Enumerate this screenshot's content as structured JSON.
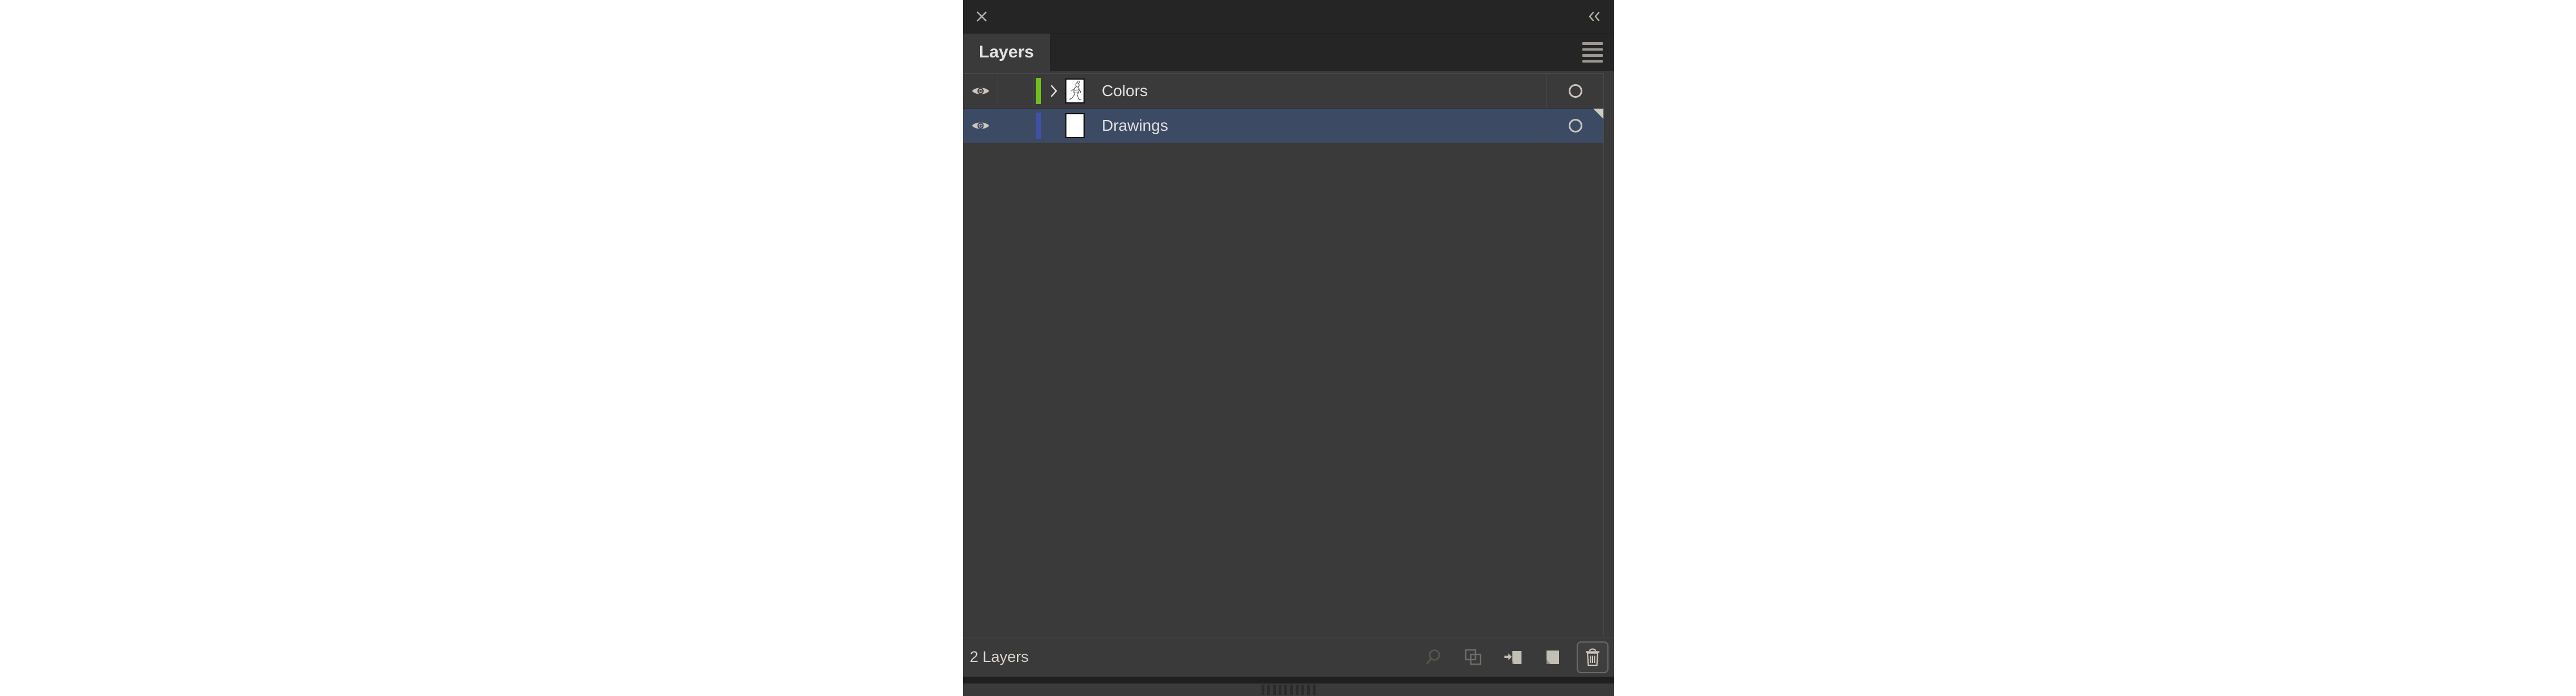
{
  "panel": {
    "title_tab": "Layers",
    "close_icon": "close-icon",
    "collapse_icon": "collapse-to-icons-icon",
    "menu_icon": "panel-menu-icon",
    "colors": {
      "panel_bg": "#3a3a3a",
      "titlebar_bg": "#252525",
      "tab_active_bg": "#3a3a3a",
      "row_selected_bg": "#3d4a63",
      "text": "#e0e0e0",
      "icon": "#c9c7bd",
      "icon_disabled": "#5a5854"
    }
  },
  "layers": [
    {
      "name": "Colors",
      "visible": true,
      "locked": false,
      "selected": false,
      "expandable": true,
      "expanded": false,
      "color": "#6fbf1f",
      "color_name": "green",
      "thumbnail": "artwork-sketch-thumbnail",
      "target_state": "untargeted",
      "visibility_icon": "eye-icon",
      "disclosure_icon": "chevron-right-icon",
      "target_icon": "target-circle-icon"
    },
    {
      "name": "Drawings",
      "visible": true,
      "locked": false,
      "selected": true,
      "expandable": false,
      "expanded": false,
      "color": "#4051a8",
      "color_name": "blue-violet",
      "thumbnail": "blank-white-thumbnail",
      "target_state": "untargeted",
      "visibility_icon": "eye-icon",
      "disclosure_icon": "",
      "target_icon": "target-circle-icon"
    }
  ],
  "footer": {
    "layer_count_label": "2 Layers",
    "tools": [
      {
        "name": "locate-object-button",
        "label": "Locate Object",
        "icon": "magnifier-icon",
        "enabled": false,
        "framed": false
      },
      {
        "name": "make-clipping-mask-button",
        "label": "Make/Release Clipping Mask",
        "icon": "clipping-mask-icon",
        "enabled": true,
        "framed": false
      },
      {
        "name": "create-new-sublayer-button",
        "label": "Create New Sublayer",
        "icon": "new-sublayer-icon",
        "enabled": true,
        "framed": false
      },
      {
        "name": "create-new-layer-button",
        "label": "Create New Layer",
        "icon": "new-layer-icon",
        "enabled": true,
        "framed": false
      },
      {
        "name": "delete-selection-button",
        "label": "Delete Selection",
        "icon": "trash-icon",
        "enabled": true,
        "framed": true
      }
    ]
  }
}
